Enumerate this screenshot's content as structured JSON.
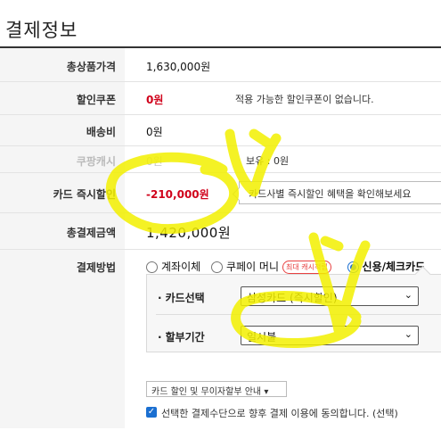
{
  "page_title": "결제정보",
  "rows": {
    "total_price": {
      "label": "총상품가격",
      "value": "1,630,000원"
    },
    "discount_coupon": {
      "label": "할인쿠폰",
      "value": "0원",
      "note": "적용 가능한 할인쿠폰이 없습니다."
    },
    "shipping": {
      "label": "배송비",
      "value": "0원"
    },
    "coupang_cash": {
      "label": "쿠팡캐시",
      "value": "0원",
      "balance": "보유 : 0원"
    },
    "card_discount": {
      "label": "카드 즉시할인",
      "value": "-210,000원",
      "tooltip": "카드사별 즉시할인 혜택을 확인해보세요"
    },
    "total_payment": {
      "label": "총결제금액",
      "value": "1,420,000원"
    },
    "payment_method": {
      "label": "결제방법",
      "options": [
        {
          "label": "계좌이체",
          "selected": false
        },
        {
          "label": "쿠페이 머니",
          "selected": false,
          "badge": "최대 캐시적립"
        },
        {
          "label": "신용/체크카드",
          "selected": true
        }
      ]
    }
  },
  "card_panel": {
    "card_select_label": "카드선택",
    "card_select_value": "삼성카드 (즉시할인)",
    "installment_label": "할부기간",
    "installment_value": "일시불"
  },
  "guide_select": "카드 할인 및 무이자할부 안내",
  "agree_text": "선택한 결제수단으로 향후 결제 이용에 동의합니다. (선택)",
  "colors": {
    "accent": "#1a6fd1",
    "discount": "#d0021b",
    "highlight": "#f3f000"
  }
}
